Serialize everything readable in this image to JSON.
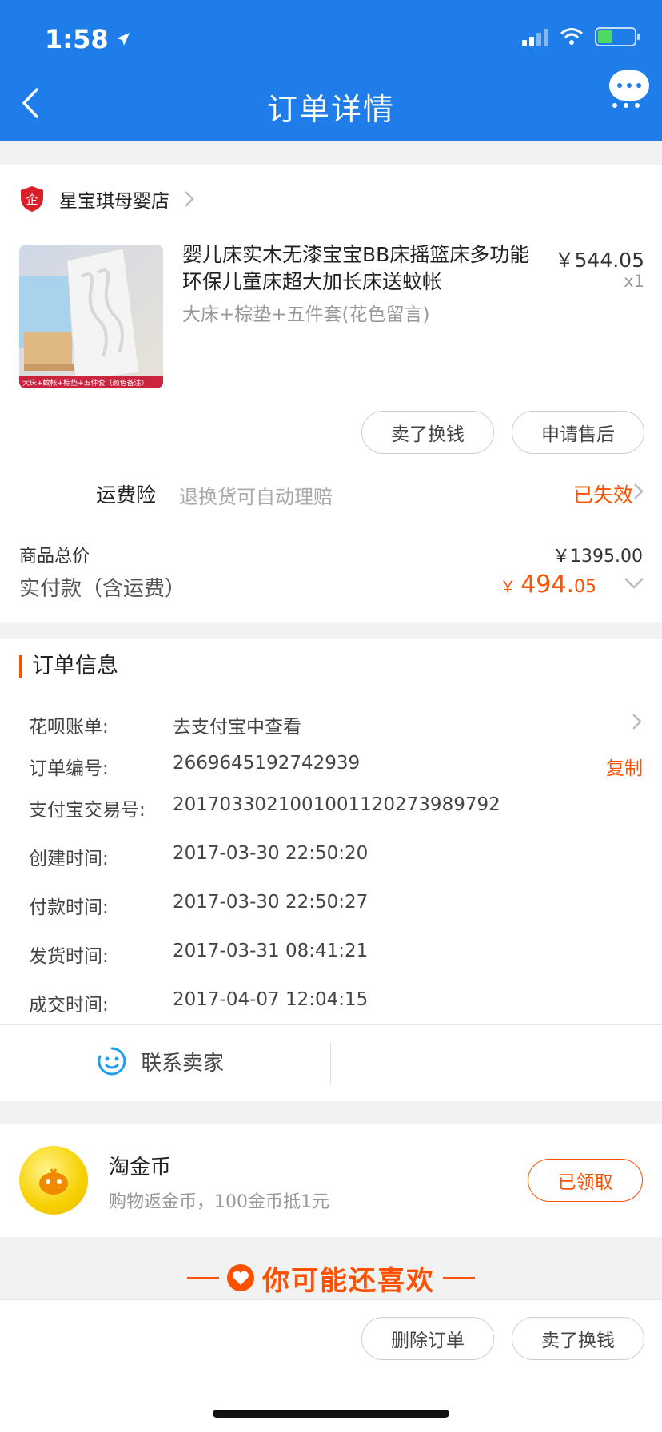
{
  "status_bar": {
    "time": "1:58"
  },
  "nav": {
    "title": "订单详情"
  },
  "shop": {
    "name": "星宝琪母婴店",
    "badge": "企"
  },
  "product": {
    "title": "婴儿床实木无漆宝宝BB床摇篮床多功能环保儿童床超大加长床送蚊帐",
    "sku": "大床+棕垫+五件套(花色留言)",
    "price": "￥544.05",
    "quantity": "x1",
    "image_caption": "大床+蚊帐+棕垫+五件套（颜色备注）"
  },
  "product_actions": {
    "sell": "卖了换钱",
    "after_sale": "申请售后"
  },
  "insurance": {
    "label": "运费险",
    "desc": "退换货可自动理赔",
    "status": "已失效"
  },
  "totals": {
    "goods_label": "商品总价",
    "goods_value": "￥1395.00",
    "paid_label": "实付款（含运费）",
    "paid_symbol": "￥",
    "paid_int": "494.",
    "paid_dec": "05"
  },
  "order_info": {
    "title": "订单信息",
    "huabei_label": "花呗账单:",
    "huabei_value": "去支付宝中查看",
    "order_no_label": "订单编号:",
    "order_no_value": "2669645192742939",
    "copy": "复制",
    "alipay_label": "支付宝交易号:",
    "alipay_value": "2017033021001001120273989792",
    "created_label": "创建时间:",
    "created_value": "2017-03-30 22:50:20",
    "paid_label": "付款时间:",
    "paid_value": "2017-03-30 22:50:27",
    "shipped_label": "发货时间:",
    "shipped_value": "2017-03-31 08:41:21",
    "closed_label": "成交时间:",
    "closed_value": "2017-04-07 12:04:15"
  },
  "contact": {
    "label": "联系卖家"
  },
  "coins": {
    "title": "淘金币",
    "desc": "购物返金币，100金币抵1元",
    "button": "已领取"
  },
  "recommend": {
    "title": "你可能还喜欢"
  },
  "bottom_actions": {
    "delete": "删除订单",
    "sell": "卖了换钱"
  },
  "colors": {
    "brand_blue": "#1e7de9",
    "accent_orange": "#ff5000"
  }
}
